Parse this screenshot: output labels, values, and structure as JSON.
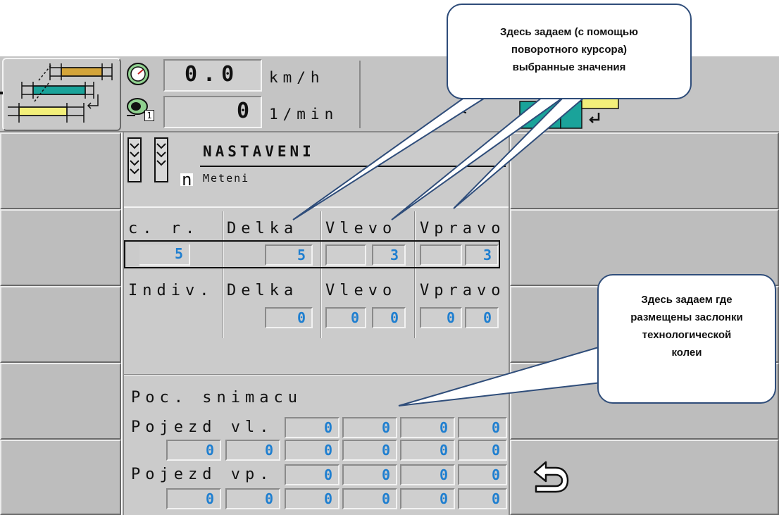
{
  "status_bar": {
    "speed_value": "0.0",
    "speed_unit": "km/h",
    "rpm_value": "0",
    "rpm_unit": "1/min",
    "rpm_index": "1"
  },
  "header": {
    "title": "NASTAVENI",
    "subtitle": "Meteni",
    "mode_glyph": "n"
  },
  "table1": {
    "headers": [
      "c. r.",
      "Delka",
      "Vlevo",
      "Vpravo"
    ],
    "values": [
      "5",
      "5",
      "3",
      "3"
    ]
  },
  "table2": {
    "headers": [
      "Indiv.",
      "Delka",
      "Vlevo",
      "Vpravo"
    ],
    "values": [
      "0",
      "0",
      "0",
      "0",
      "0"
    ]
  },
  "sensors": {
    "title": "Poc. snimacu",
    "row1_label": "Pojezd vl.",
    "row1_values": [
      "0",
      "0",
      "0",
      "0"
    ],
    "row2_values": [
      "0",
      "0",
      "0",
      "0",
      "0",
      "0"
    ],
    "row3_label": "Pojezd vp.",
    "row3_values": [
      "0",
      "0",
      "0",
      "0"
    ],
    "row4_values": [
      "0",
      "0",
      "0",
      "0",
      "0",
      "0"
    ]
  },
  "callouts": {
    "top": "Здесь задаем (с помощью поворотного курсора) выбранные значения",
    "right": "Здесь задаем где размещены заслонки технологической колеи"
  },
  "colors": {
    "value_blue": "#1f7fd0",
    "panel_gray": "#cbcbcb",
    "callout_border": "#2f4d7a",
    "icon_orange": "#d4a53a",
    "icon_teal": "#1aa39a",
    "icon_yellow": "#f3ef7a"
  },
  "icons": [
    "speedometer-icon",
    "rpm-sensor-icon",
    "tramline-pattern-icon",
    "tramline-config-icon",
    "enter-icon",
    "back-arrow-icon"
  ]
}
